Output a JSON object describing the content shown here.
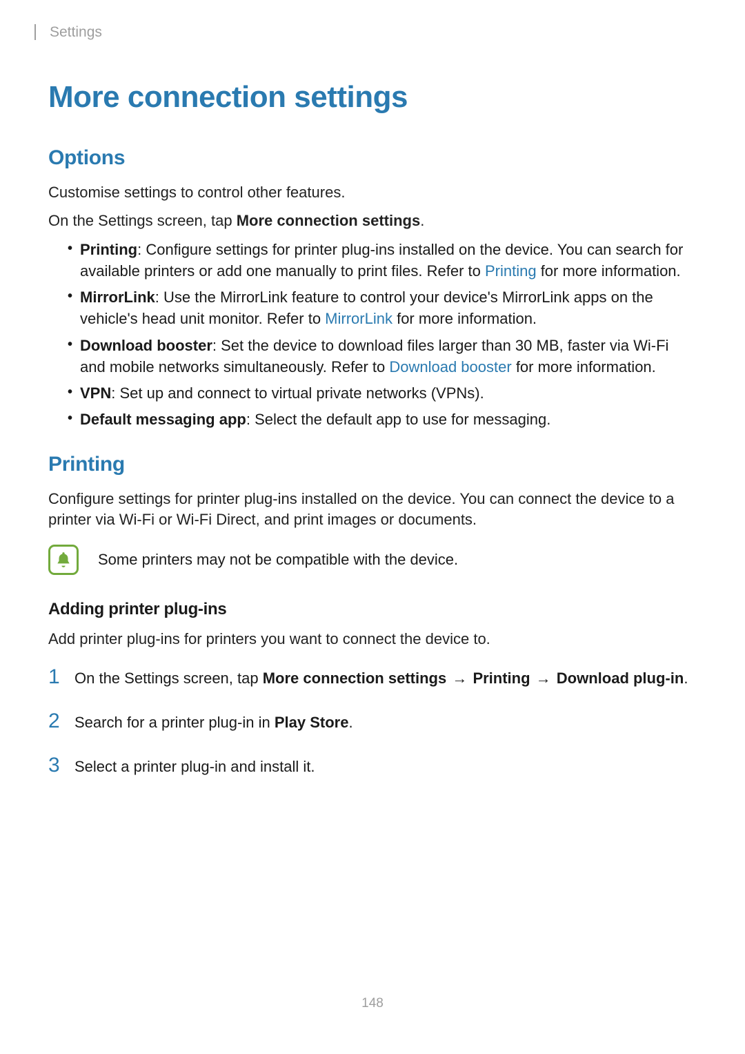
{
  "breadcrumb": "Settings",
  "h1": "More connection settings",
  "options": {
    "heading": "Options",
    "intro": "Customise settings to control other features.",
    "instruction_prefix": "On the Settings screen, tap ",
    "instruction_bold": "More connection settings",
    "instruction_suffix": ".",
    "items": {
      "printing": {
        "label": "Printing",
        "text_a": ": Configure settings for printer plug-ins installed on the device. You can search for available printers or add one manually to print files. Refer to ",
        "link": "Printing",
        "text_b": " for more information."
      },
      "mirrorlink": {
        "label": "MirrorLink",
        "text_a": ": Use the MirrorLink feature to control your device's MirrorLink apps on the vehicle's head unit monitor. Refer to ",
        "link": "MirrorLink",
        "text_b": " for more information."
      },
      "download": {
        "label": "Download booster",
        "text_a": ": Set the device to download files larger than 30 MB, faster via Wi-Fi and mobile networks simultaneously. Refer to ",
        "link": "Download booster",
        "text_b": " for more information."
      },
      "vpn": {
        "label": "VPN",
        "text": ": Set up and connect to virtual private networks (VPNs)."
      },
      "messaging": {
        "label": "Default messaging app",
        "text": ": Select the default app to use for messaging."
      }
    }
  },
  "printing": {
    "heading": "Printing",
    "intro": "Configure settings for printer plug-ins installed on the device. You can connect the device to a printer via Wi-Fi or Wi-Fi Direct, and print images or documents.",
    "note": "Some printers may not be compatible with the device.",
    "sub_heading": "Adding printer plug-ins",
    "sub_intro": "Add printer plug-ins for printers you want to connect the device to.",
    "steps": {
      "s1": {
        "num": "1",
        "pre": "On the Settings screen, tap ",
        "b1": "More connection settings",
        "arrow": " → ",
        "b2": "Printing",
        "b3": "Download plug-in",
        "suffix": "."
      },
      "s2": {
        "num": "2",
        "pre": "Search for a printer plug-in in ",
        "b1": "Play Store",
        "suffix": "."
      },
      "s3": {
        "num": "3",
        "text": "Select a printer plug-in and install it."
      }
    }
  },
  "page_number": "148"
}
